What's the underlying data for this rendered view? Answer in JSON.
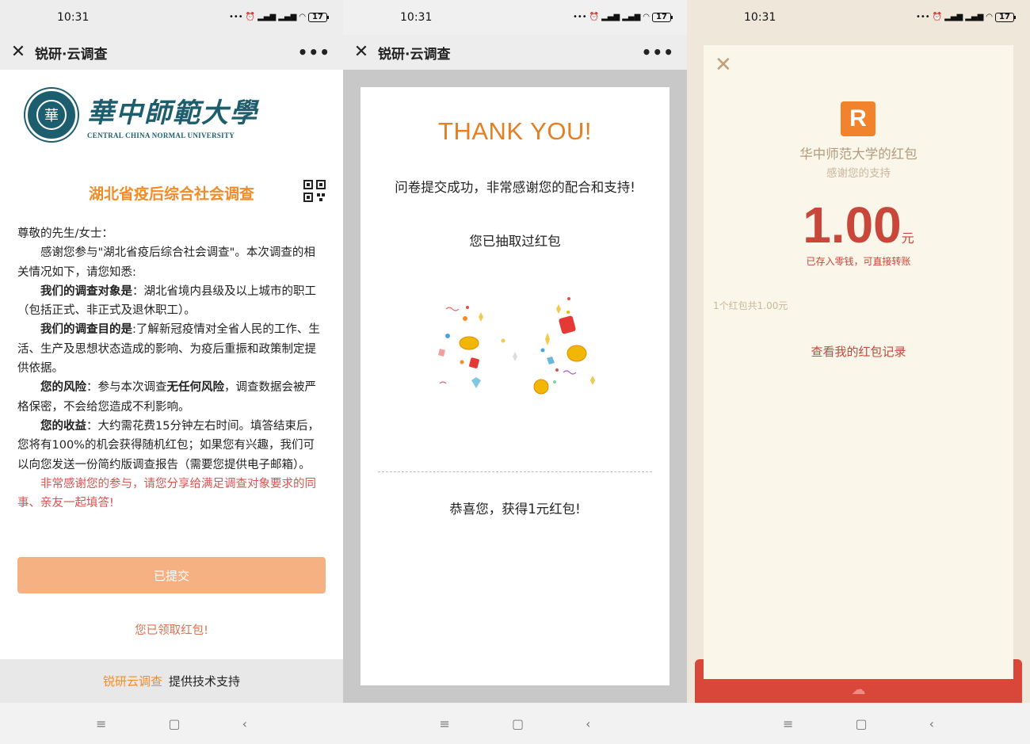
{
  "status": {
    "time": "10:31",
    "battery": "17"
  },
  "screen1": {
    "app_title": "锐研·云调查",
    "logo": {
      "cn": "華中師範大學",
      "en": "CENTRAL CHINA NORMAL UNIVERSITY",
      "seal_char": "華"
    },
    "survey_title": "湖北省疫后综合社会调查",
    "greeting": "尊敬的先生/女士：",
    "para1": "感谢您参与\"湖北省疫后综合社会调查\"。本次调查的相关情况如下，请您知悉:",
    "target_label": "我们的调查对象是",
    "target_text": "：湖北省境内县级及以上城市的职工（包括正式、非正式及退休职工）。",
    "purpose_label": "我们的调查目的是",
    "purpose_text": ":了解新冠疫情对全省人民的工作、生活、生产及思想状态造成的影响、为疫后重振和政策制定提供依据。",
    "risk_label": "您的风险",
    "risk_text_a": "：参与本次调查",
    "risk_bold": "无任何风险",
    "risk_text_b": "，调查数据会被严格保密，不会给您造成不利影响。",
    "benefit_label": "您的收益",
    "benefit_text": "：大约需花费15分钟左右时间。填答结束后，您将有100%的机会获得随机红包；如果您有兴趣，我们可以向您发送一份简约版调查报告（需要您提供电子邮箱）。",
    "share_text": "非常感谢您的参与，请您分享给满足调查对象要求的同事、亲友一起填答!",
    "submitted_button": "已提交",
    "received_text": "您已领取红包!",
    "powered_brand": "锐研云调查",
    "powered_text": "提供技术支持"
  },
  "screen2": {
    "app_title": "锐研·云调查",
    "thanks": "THANK YOU!",
    "success": "问卷提交成功，非常感谢您的配合和支持!",
    "drawn": "您已抽取过红包",
    "congrats": "恭喜您，获得1元红包!"
  },
  "screen3": {
    "from": "华中师范大学的红包",
    "thanks": "感谢您的支持",
    "amount": "1.00",
    "unit": "元",
    "note": "已存入零钱，可直接转账",
    "count": "1个红包共1.00元",
    "record_link": "查看我的红包记录",
    "logo_letter": "R"
  },
  "nav": {
    "menu": "≡",
    "home": "▢",
    "back": "‹"
  },
  "colors": {
    "orange": "#f28c28",
    "red": "#c8463a",
    "seal": "#1d5e6e"
  }
}
